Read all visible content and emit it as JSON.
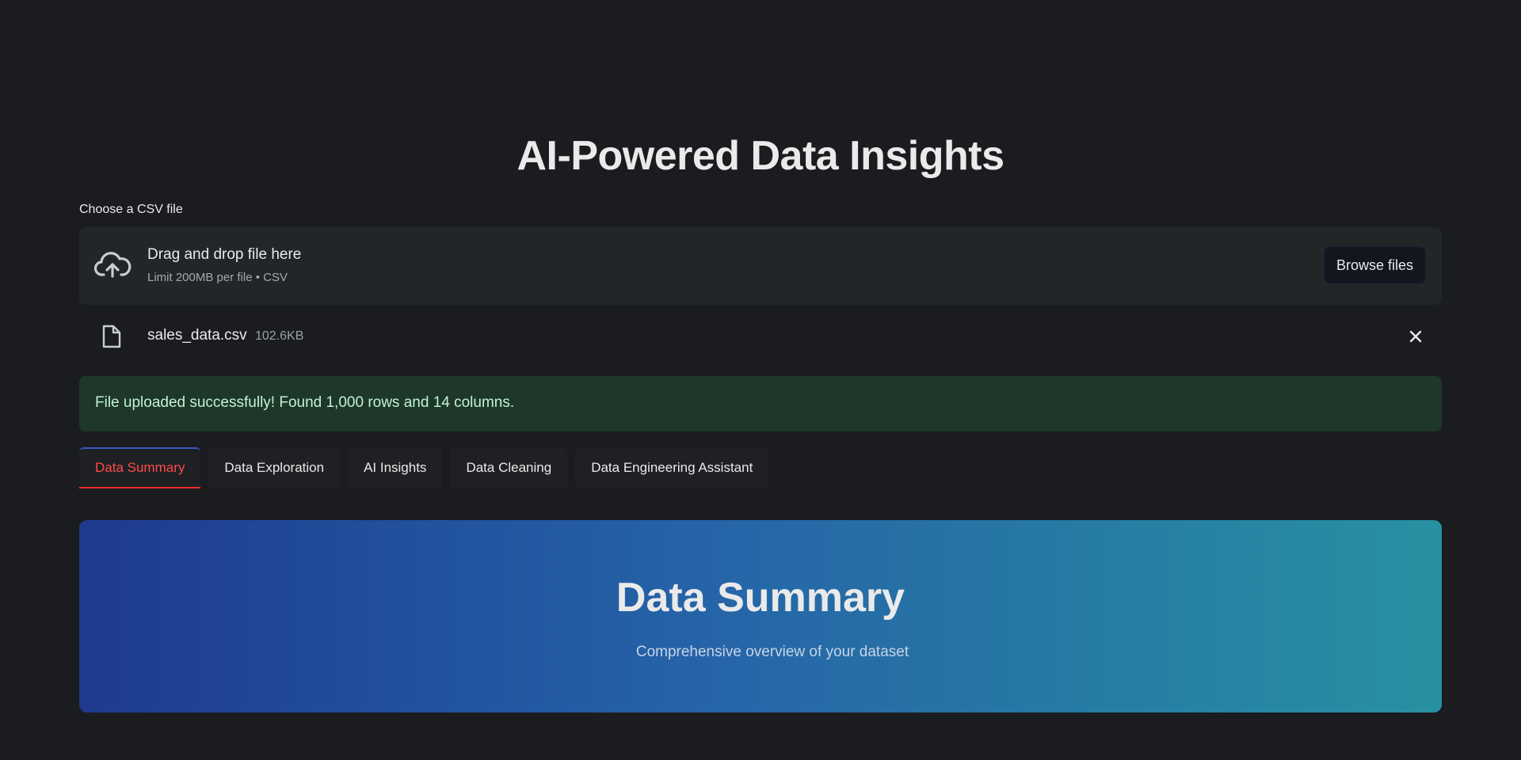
{
  "app": {
    "title": "AI-Powered Data Insights"
  },
  "uploader": {
    "label": "Choose a CSV file",
    "drop_title": "Drag and drop file here",
    "drop_subtitle": "Limit 200MB per file • CSV",
    "browse_label": "Browse files",
    "icon": "cloud-upload-icon"
  },
  "file": {
    "name": "sales_data.csv",
    "size": "102.6KB",
    "icon": "file-icon",
    "remove_icon": "close-icon"
  },
  "alert": {
    "message": "File uploaded successfully! Found 1,000 rows and 14 columns.",
    "color": "#c0f4d0"
  },
  "tabs": [
    {
      "label": "Data Summary",
      "active": true
    },
    {
      "label": "Data Exploration",
      "active": false
    },
    {
      "label": "AI Insights",
      "active": false
    },
    {
      "label": "Data Cleaning",
      "active": false
    },
    {
      "label": "Data Engineering Assistant",
      "active": false
    }
  ],
  "hero": {
    "title": "Data Summary",
    "subtitle": "Comprehensive overview of your dataset"
  },
  "colors": {
    "background": "#1b1c1f",
    "active_tab": "#ff4b4b",
    "hero_gradient_start": "#1e3a8f",
    "hero_gradient_end": "#2891a1"
  }
}
